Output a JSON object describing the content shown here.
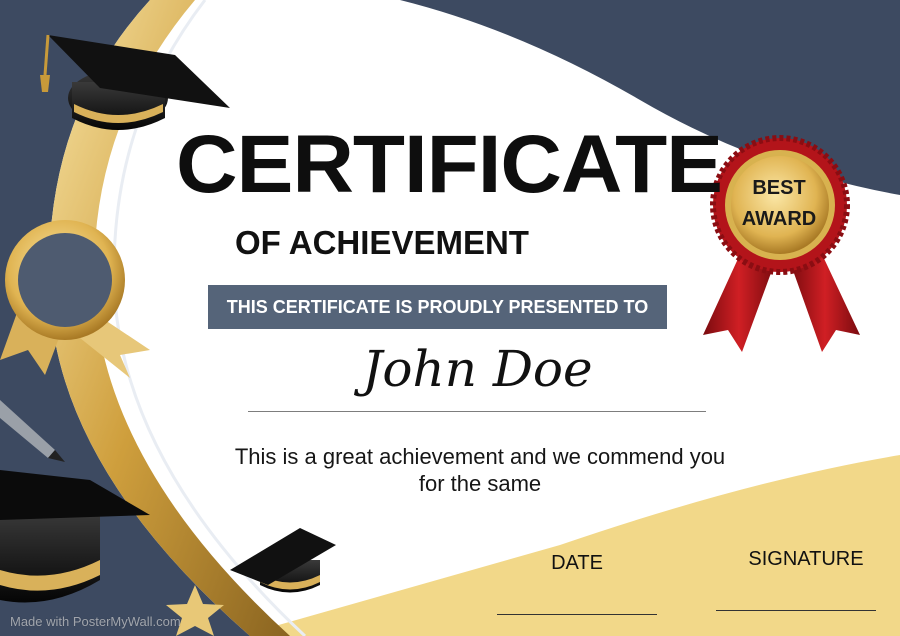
{
  "certificate": {
    "title": "CERTIFICATE",
    "subtitle": "OF ACHIEVEMENT",
    "presented_to": "THIS CERTIFICATE IS PROUDLY PRESENTED TO",
    "recipient_name": "John Doe",
    "body_line_1": "This is a great achievement and we commend you",
    "body_line_2": "for the same",
    "date_label": "DATE",
    "signature_label": "SIGNATURE"
  },
  "badge": {
    "line_1": "BEST",
    "line_2": "AWARD"
  },
  "watermark": "Made with PosterMyWall.com",
  "colors": {
    "navy": "#3d4a61",
    "gold": "#d4ab52",
    "cream_gold": "#f2d889",
    "banner": "#556479",
    "ribbon_red": "#b3141a"
  },
  "icons": [
    "graduation-cap-icon",
    "medal-ribbon-icon",
    "blank-rosette-icon",
    "pen-icon",
    "star-icon"
  ]
}
